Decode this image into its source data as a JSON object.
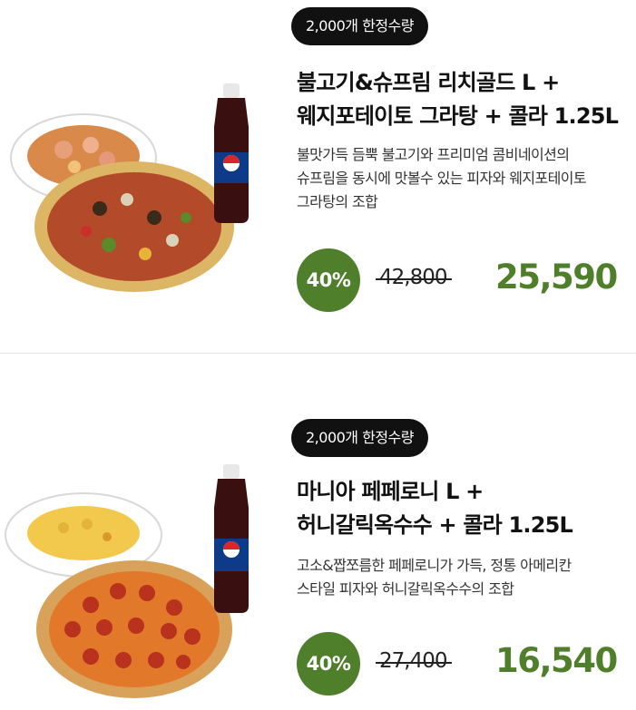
{
  "products": [
    {
      "badge": "2,000개 한정수량",
      "title_line1": "불고기&슈프림 리치골드 L +",
      "title_line2": "웨지포테이토 그라탕 + 콜라 1.25L",
      "desc_line1": "불맛가득 듬뿍 불고기와 프리미엄 콤비네이션의",
      "desc_line2": "슈프림을 동시에 맛볼수 있는 피자와 웨지포테이토",
      "desc_line3": "그라탕의 조합",
      "discount": "40%",
      "original_price": "42,800",
      "sale_price": "25,590",
      "image_icon": "pizza-potato-gratin-cola-image"
    },
    {
      "badge": "2,000개 한정수량",
      "title_line1": "마니아 페페로니 L +",
      "title_line2": "허니갈릭옥수수 + 콜라 1.25L",
      "desc_line1": "고소&짭쪼름한 페페로니가 가득, 정통 아메리칸",
      "desc_line2": " 스타일 피자와 허니갈릭옥수수의 조합",
      "discount": "40%",
      "original_price": "27,400",
      "sale_price": "16,540",
      "image_icon": "pepperoni-pizza-corn-cola-image"
    }
  ],
  "colors": {
    "accent_green": "#4f7f2a",
    "badge_bg": "#111111",
    "bottle_label": "pepsi"
  }
}
